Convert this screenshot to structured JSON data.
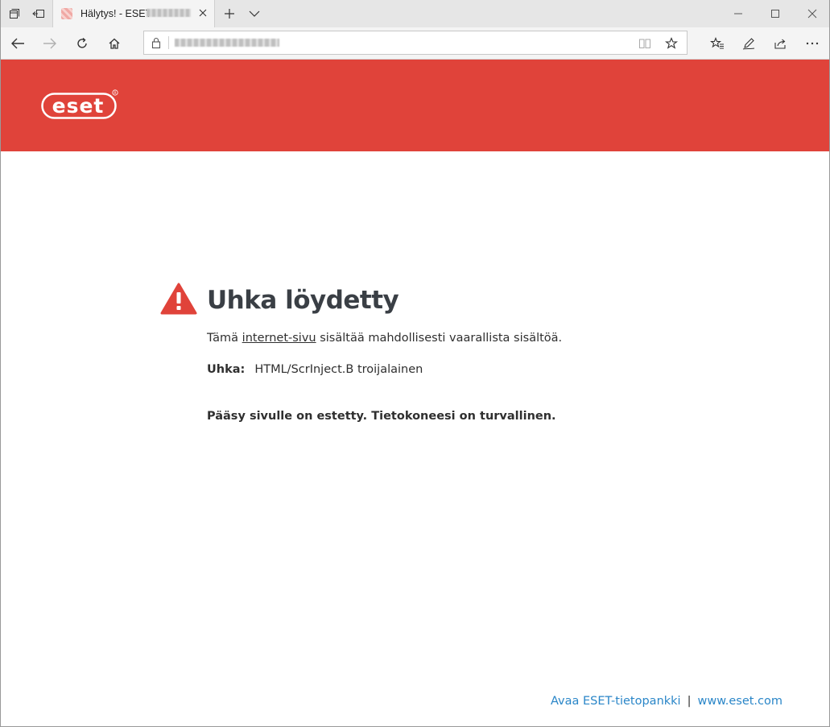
{
  "browser": {
    "tab_title": "Hälytys! - ESET",
    "icons": {
      "tab_actions": "tab-actions-icon",
      "set_aside": "set-aside-tabs-icon",
      "new_tab": "plus-icon",
      "tab_list": "chevron-down-icon",
      "close_tab": "close-icon",
      "minimize": "minimize-icon",
      "maximize": "maximize-icon",
      "close_window": "close-window-icon",
      "back": "back-arrow-icon",
      "forward": "forward-arrow-icon",
      "refresh": "refresh-icon",
      "home": "home-icon",
      "lock": "lock-icon",
      "reading_view": "reading-view-icon",
      "favorite": "star-icon",
      "favorites_list": "favorites-icon",
      "notes": "pen-icon",
      "share": "share-icon",
      "more": "more-icon"
    }
  },
  "page": {
    "brand_color": "#e0433a",
    "logo_text": "eset",
    "title": "Uhka löydetty",
    "desc_before": "Tämä ",
    "desc_link": "internet-sivu",
    "desc_after": " sisältää mahdollisesti vaarallista sisältöä.",
    "threat_label": "Uhka:",
    "threat_value": "HTML/ScrInject.B troijalainen",
    "blocked_message": "Pääsy sivulle on estetty. Tietokoneesi on turvallinen.",
    "footer": {
      "kb_link": "Avaa ESET-tietopankki",
      "separator": "|",
      "site_link": "www.eset.com",
      "link_color": "#2a86c8"
    }
  }
}
